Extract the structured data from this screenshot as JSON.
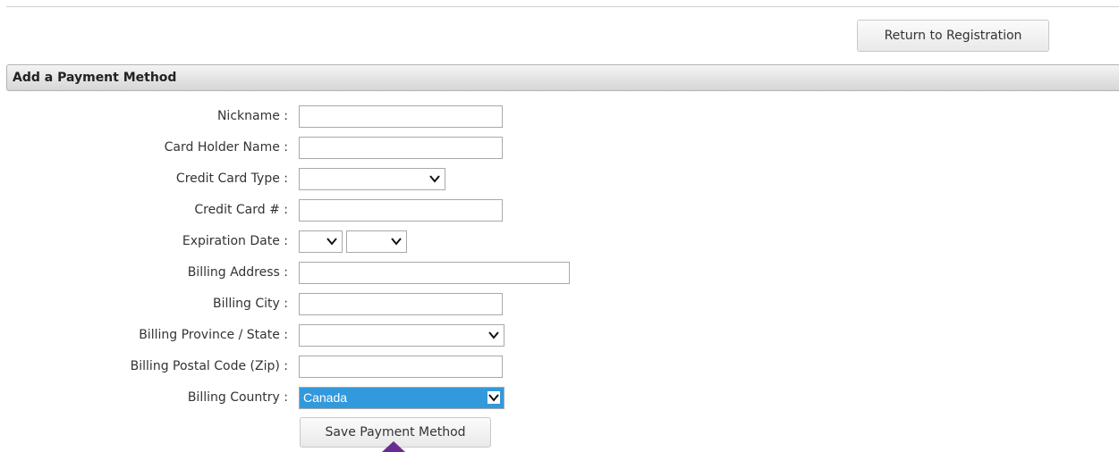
{
  "header": {
    "return_button": "Return to Registration"
  },
  "section": {
    "title": "Add a Payment Method"
  },
  "form": {
    "nickname_label": "Nickname :",
    "card_holder_label": "Card Holder Name :",
    "card_type_label": "Credit Card Type :",
    "card_number_label": "Credit Card # :",
    "expiration_label": "Expiration Date :",
    "address_label": "Billing Address :",
    "city_label": "Billing City :",
    "province_label": "Billing Province / State :",
    "postal_label": "Billing Postal Code (Zip) :",
    "country_label": "Billing Country :",
    "country_value": "Canada",
    "save_button": "Save Payment Method"
  },
  "icons": {
    "dropdown": "chevron-down-icon",
    "cursor": "mouse-cursor-icon"
  },
  "colors": {
    "selected_bg": "#3399dd",
    "cursor": "#6a2c91"
  }
}
